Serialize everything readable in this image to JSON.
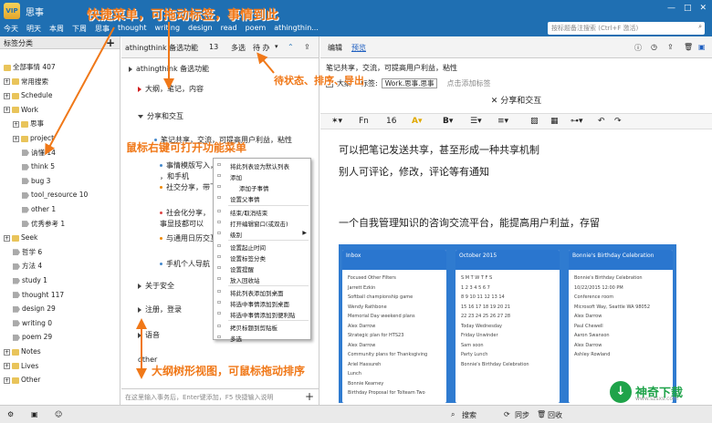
{
  "app": {
    "logo": "VIP",
    "title": "思事",
    "window_buttons": [
      "—",
      "□",
      "✕"
    ]
  },
  "quick_menu": [
    "今天",
    "明天",
    "本周",
    "下周",
    "思事",
    "thought",
    "writing",
    "design",
    "read",
    "poem",
    "athingthin..."
  ],
  "search": {
    "placeholder": "按标题备注搜索 (Ctrl+F 激活)"
  },
  "sidebar": {
    "header": "标签分类",
    "plus": "+",
    "items": [
      {
        "label": "全部事情 407",
        "type": "root"
      },
      {
        "label": "常用搜索",
        "type": "folder"
      },
      {
        "label": "Schedule",
        "type": "folder"
      },
      {
        "label": "Work",
        "type": "folder"
      },
      {
        "label": "思事",
        "type": "folder"
      },
      {
        "label": "project",
        "type": "folder"
      },
      {
        "label": "讷懂 14",
        "type": "tag"
      },
      {
        "label": "think 5",
        "type": "tag"
      },
      {
        "label": "bug 3",
        "type": "tag"
      },
      {
        "label": "tool_resource 10",
        "type": "tag"
      },
      {
        "label": "other 1",
        "type": "tag"
      },
      {
        "label": "优秀参考 1",
        "type": "tag"
      },
      {
        "label": "Seek",
        "type": "folder"
      },
      {
        "label": "哲学 6",
        "type": "tag"
      },
      {
        "label": "方法 4",
        "type": "tag"
      },
      {
        "label": "study 1",
        "type": "tag"
      },
      {
        "label": "thought 117",
        "type": "tag"
      },
      {
        "label": "design 29",
        "type": "tag"
      },
      {
        "label": "writing 0",
        "type": "tag"
      },
      {
        "label": "poem 29",
        "type": "tag"
      },
      {
        "label": "Notes",
        "type": "folder"
      },
      {
        "label": "Lives",
        "type": "folder"
      },
      {
        "label": "Other",
        "type": "folder"
      }
    ]
  },
  "middle": {
    "title": "athingthink 备选功能",
    "count": "13",
    "sort_label": "多选",
    "status_label": "待 办",
    "outline": [
      "athingthink 备选功能",
      "大纲，笔记，内容",
      "分享和交互",
      "笔记共享，交流，可提高用户利益，粘性",
      "事情模版写入，",
      "，和手机",
      "社交分享，带飞",
      "社会化分享，",
      "事显技都可以",
      "与通用日历交互",
      "手机个人导航",
      "关于安全",
      "注册，登录",
      "语音",
      "other"
    ],
    "input_placeholder": "在这里输入事务后，Enter键添加，F5 快捷输入说明",
    "input_plus": "+"
  },
  "editor": {
    "tabs": [
      "编辑",
      "预览"
    ],
    "meta": "笔记共享，交流，可提高用户利益，粘性",
    "outline_checkbox": "大纲",
    "tag_label": "标签:",
    "tags": "Work.思事.思事",
    "add_tag": "点击添加标签",
    "title": "分享和交互",
    "toolbar": {
      "font": "Fn",
      "size": "16"
    },
    "paragraphs": [
      "可以把笔记发送共享，甚至形成一种共享机制",
      "别人可评论，修改，评论等有通知",
      "一个自我管理知识的咨询交流平台，能提高用户利益，存留"
    ]
  },
  "phones": [
    {
      "header": "Inbox",
      "lines": [
        "Focused  Other  Filters",
        "Jarrett Ezkin",
        "Softball championship game",
        "Wendy Rathbone",
        "Memorial Day weekend plans",
        "Alex Darrow",
        "Strategic plan for HTS23",
        "Alex Darrow",
        "Community plans for Thanksgiving",
        "Ariel Hassureh",
        "Lunch",
        "Bonnie Kearney",
        "Birthday Proposal for Tolteam Two"
      ]
    },
    {
      "header": "October 2015",
      "lines": [
        "S M T W T F S",
        "1 2 3 4 5 6 7",
        "8 9 10 11 12 13 14",
        "15 16 17 18 19 20 21",
        "22 23 24 25 26 27 28",
        "Today Wednesday",
        "Friday Unwinder",
        "Sam soon",
        "Party Lunch",
        "Bonnie's Birthday Celebration"
      ]
    },
    {
      "header": "Bonnie's Birthday Celebration",
      "lines": [
        "Bonnie's Birthday Celebration",
        "10/22/2015 12:00 PM",
        "Conference room",
        "Microsoft Way, Seattle WA 98052",
        "Alex Darrow",
        "Paul Chewell",
        "Aaron Swanson",
        "Alex Darrow",
        "Ashley Rowland"
      ]
    }
  ],
  "context_menu": [
    "将此列表设为默认列表",
    "添加",
    "添加子事情",
    "设置父事情",
    "结束/取消结束",
    "打开编辑窗口(或双击)",
    "级别",
    "设置起止时间",
    "设置标签分类",
    "设置提醒",
    "放入回收站",
    "将此列表添加到桌面",
    "将选中事情添加到桌面",
    "将选中事情添加到便利贴",
    "拷贝标题到剪贴板",
    "多选"
  ],
  "annotations": [
    "快捷菜单，可拖动标签，事情到此",
    "待状态、排序、导出",
    "鼠标右键可打开功能菜单",
    "大纲树形视图，可鼠标拖动排序"
  ],
  "statusbar": [
    "搜索",
    "同步",
    "回收"
  ],
  "watermark": {
    "text": "神奇下载",
    "sub": "www.szsxs.com",
    "icon": "↓"
  }
}
